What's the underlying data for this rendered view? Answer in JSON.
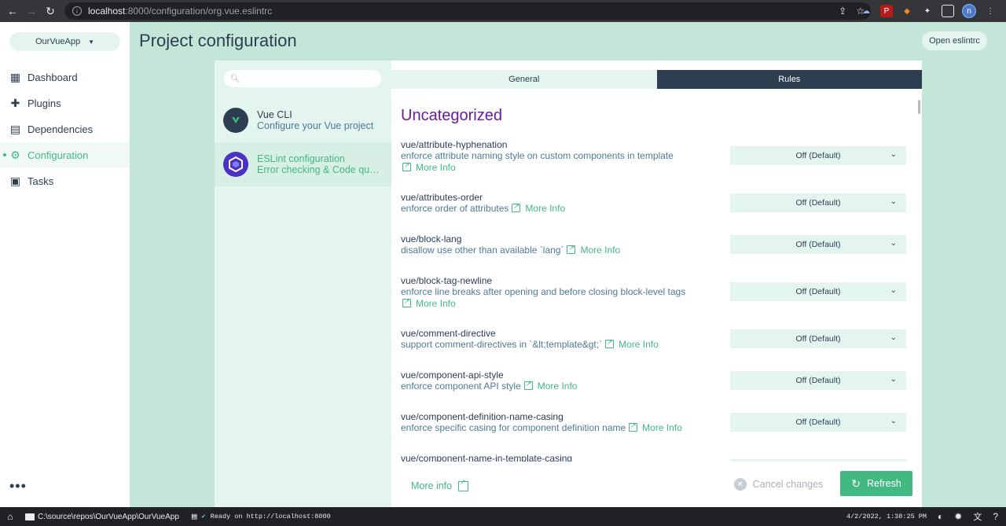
{
  "browser": {
    "url_host": "localhost",
    "url_rest": ":8000/configuration/org.vue.eslintrc",
    "avatar_letter": "n"
  },
  "sidebar": {
    "project": "OurVueApp",
    "items": [
      {
        "label": "Dashboard",
        "icon": "dashboard-icon"
      },
      {
        "label": "Plugins",
        "icon": "puzzle-icon"
      },
      {
        "label": "Dependencies",
        "icon": "library-icon"
      },
      {
        "label": "Configuration",
        "icon": "settings-icon"
      },
      {
        "label": "Tasks",
        "icon": "clipboard-icon"
      }
    ],
    "active": "Configuration",
    "more": "•••"
  },
  "header": {
    "title": "Project configuration",
    "open_button": "Open eslintrc"
  },
  "configs": [
    {
      "name": "Vue CLI",
      "desc": "Configure your Vue project"
    },
    {
      "name": "ESLint configuration",
      "desc": "Error checking & Code quality"
    }
  ],
  "tabs": [
    "General",
    "Rules"
  ],
  "selected_tab": "Rules",
  "section_title": "Uncategorized",
  "more_info_label": "More Info",
  "rules": [
    {
      "name": "vue/attribute-hyphenation",
      "desc": "enforce attribute naming style on custom components in template",
      "value": "Off (Default)"
    },
    {
      "name": "vue/attributes-order",
      "desc": "enforce order of attributes",
      "value": "Off (Default)"
    },
    {
      "name": "vue/block-lang",
      "desc": "disallow use other than available `lang`",
      "value": "Off (Default)"
    },
    {
      "name": "vue/block-tag-newline",
      "desc": "enforce line breaks after opening and before closing block-level tags",
      "value": "Off (Default)"
    },
    {
      "name": "vue/comment-directive",
      "desc": "support comment-directives in `&lt;template&gt;`",
      "value": "Off (Default)"
    },
    {
      "name": "vue/component-api-style",
      "desc": "enforce component API style",
      "value": "Off (Default)"
    },
    {
      "name": "vue/component-definition-name-casing",
      "desc": "enforce specific casing for component definition name",
      "value": "Off (Default)"
    },
    {
      "name": "vue/component-name-in-template-casing",
      "desc": "",
      "value": ""
    }
  ],
  "footer": {
    "more_info": "More info",
    "cancel": "Cancel changes",
    "refresh": "Refresh"
  },
  "statusbar": {
    "path": "C:\\source\\repos\\OurVueApp\\OurVueApp",
    "log": "Ready on http://localhost:8000",
    "datetime": "4/2/2022, 1:38:25 PM"
  },
  "colors": {
    "accent": "#42b983",
    "dark": "#2c3e50",
    "background": "#c3e6d9",
    "title_purple": "#6a1b9a"
  }
}
